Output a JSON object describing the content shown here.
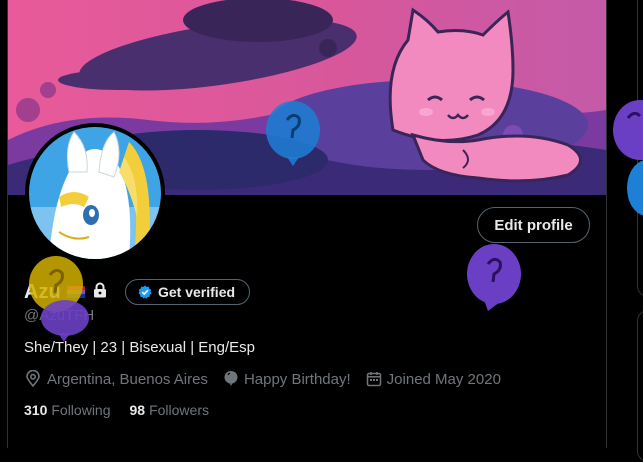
{
  "profile": {
    "display_name": "Azu",
    "handle": "@AzuTFH",
    "bio": "She/They | 23 | Bisexual | Eng/Esp",
    "location": "Argentina, Buenos Aires",
    "birthday": "Happy Birthday!",
    "joined": "Joined May 2020",
    "following_count": "310",
    "following_label": "Following",
    "followers_count": "98",
    "followers_label": "Followers"
  },
  "actions": {
    "edit_profile": "Edit profile",
    "get_verified": "Get verified"
  },
  "icons": {
    "location": "location-pin-icon",
    "birthday": "balloon-icon",
    "joined": "calendar-icon",
    "protected": "lock-icon",
    "verified": "verified-badge-icon"
  },
  "colors": {
    "background": "#000000",
    "text_primary": "#e7e9ea",
    "text_secondary": "#71767b",
    "border": "#536471",
    "verified_blue": "#1d9bf0",
    "balloon_blue": "#1d7fd6",
    "balloon_purple": "#6b3fc4",
    "balloon_yellow": "#d4b100"
  }
}
